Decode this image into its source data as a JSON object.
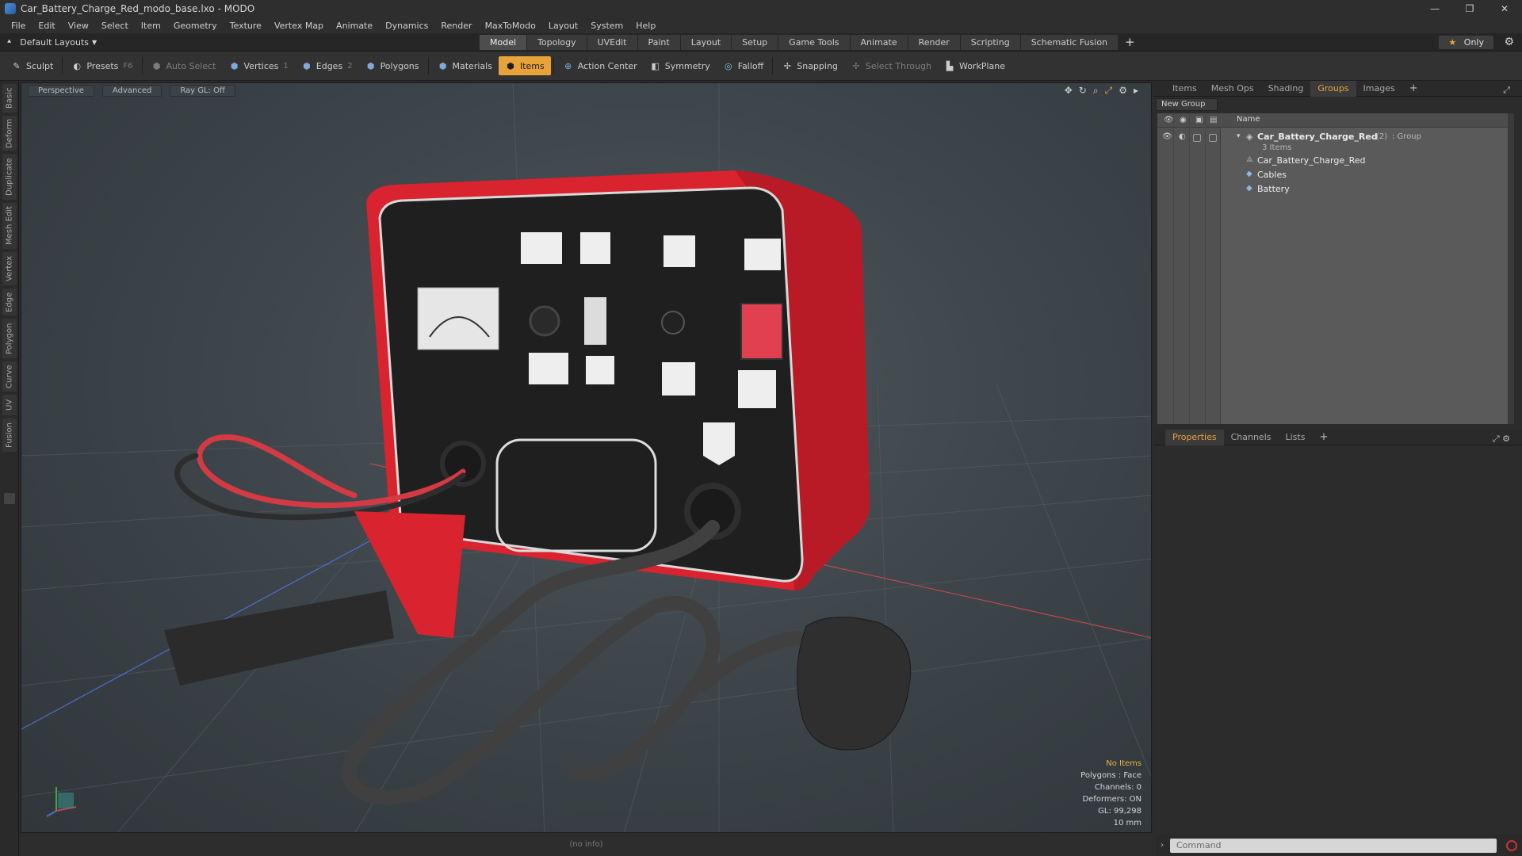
{
  "window": {
    "title": "Car_Battery_Charge_Red_modo_base.lxo - MODO",
    "controls": [
      "—",
      "❐",
      "✕"
    ]
  },
  "menu": [
    "File",
    "Edit",
    "View",
    "Select",
    "Item",
    "Geometry",
    "Texture",
    "Vertex Map",
    "Animate",
    "Dynamics",
    "Render",
    "MaxToModo",
    "Layout",
    "System",
    "Help"
  ],
  "layout_bar": {
    "layout_selector": "Default Layouts",
    "tabs": [
      "Model",
      "Topology",
      "UVEdit",
      "Paint",
      "Layout",
      "Setup",
      "Game Tools",
      "Animate",
      "Render",
      "Scripting",
      "Schematic Fusion"
    ],
    "active_tab": "Model",
    "plus": "+",
    "only_label": "Only"
  },
  "toolbar": {
    "sculpt": "Sculpt",
    "presets": "Presets",
    "presets_key": "F6",
    "auto_select": "Auto Select",
    "vertices": "Vertices",
    "vertices_count": "1",
    "edges": "Edges",
    "edges_count": "2",
    "polygons": "Polygons",
    "materials": "Materials",
    "items": "Items",
    "action_center": "Action Center",
    "symmetry": "Symmetry",
    "falloff": "Falloff",
    "snapping": "Snapping",
    "select_through": "Select Through",
    "workplane": "WorkPlane"
  },
  "left_tabs": [
    "Basic",
    "Deform",
    "Duplicate",
    "Mesh Edit",
    "Vertex",
    "Edge",
    "Polygon",
    "Curve",
    "UV",
    "Fusion"
  ],
  "viewport": {
    "view_mode": "Perspective",
    "shading": "Advanced",
    "raygl": "Ray GL: Off",
    "stats": {
      "no_items": "No Items",
      "polygons": "Polygons : Face",
      "channels": "Channels: 0",
      "deformers": "Deformers: ON",
      "gl": "GL: 99,298",
      "scale": "10 mm"
    },
    "status": "(no info)"
  },
  "panel_top": {
    "tabs": [
      "Items",
      "Mesh Ops",
      "Shading",
      "Groups",
      "Images"
    ],
    "active_tab": "Groups",
    "new_group": "New Group",
    "name_header": "Name",
    "group": {
      "name": "Car_Battery_Charge_Red",
      "count": "(2)",
      "type": ": Group",
      "items_count": "3 Items",
      "children": [
        "Car_Battery_Charge_Red",
        "Cables",
        "Battery"
      ]
    }
  },
  "panel_bottom": {
    "tabs": [
      "Properties",
      "Channels",
      "Lists"
    ],
    "active_tab": "Properties"
  },
  "command": {
    "placeholder": "Command"
  },
  "colors": {
    "accent": "#e7a33a",
    "charger_red": "#d9232f",
    "panel_black": "#1f1f1f"
  }
}
